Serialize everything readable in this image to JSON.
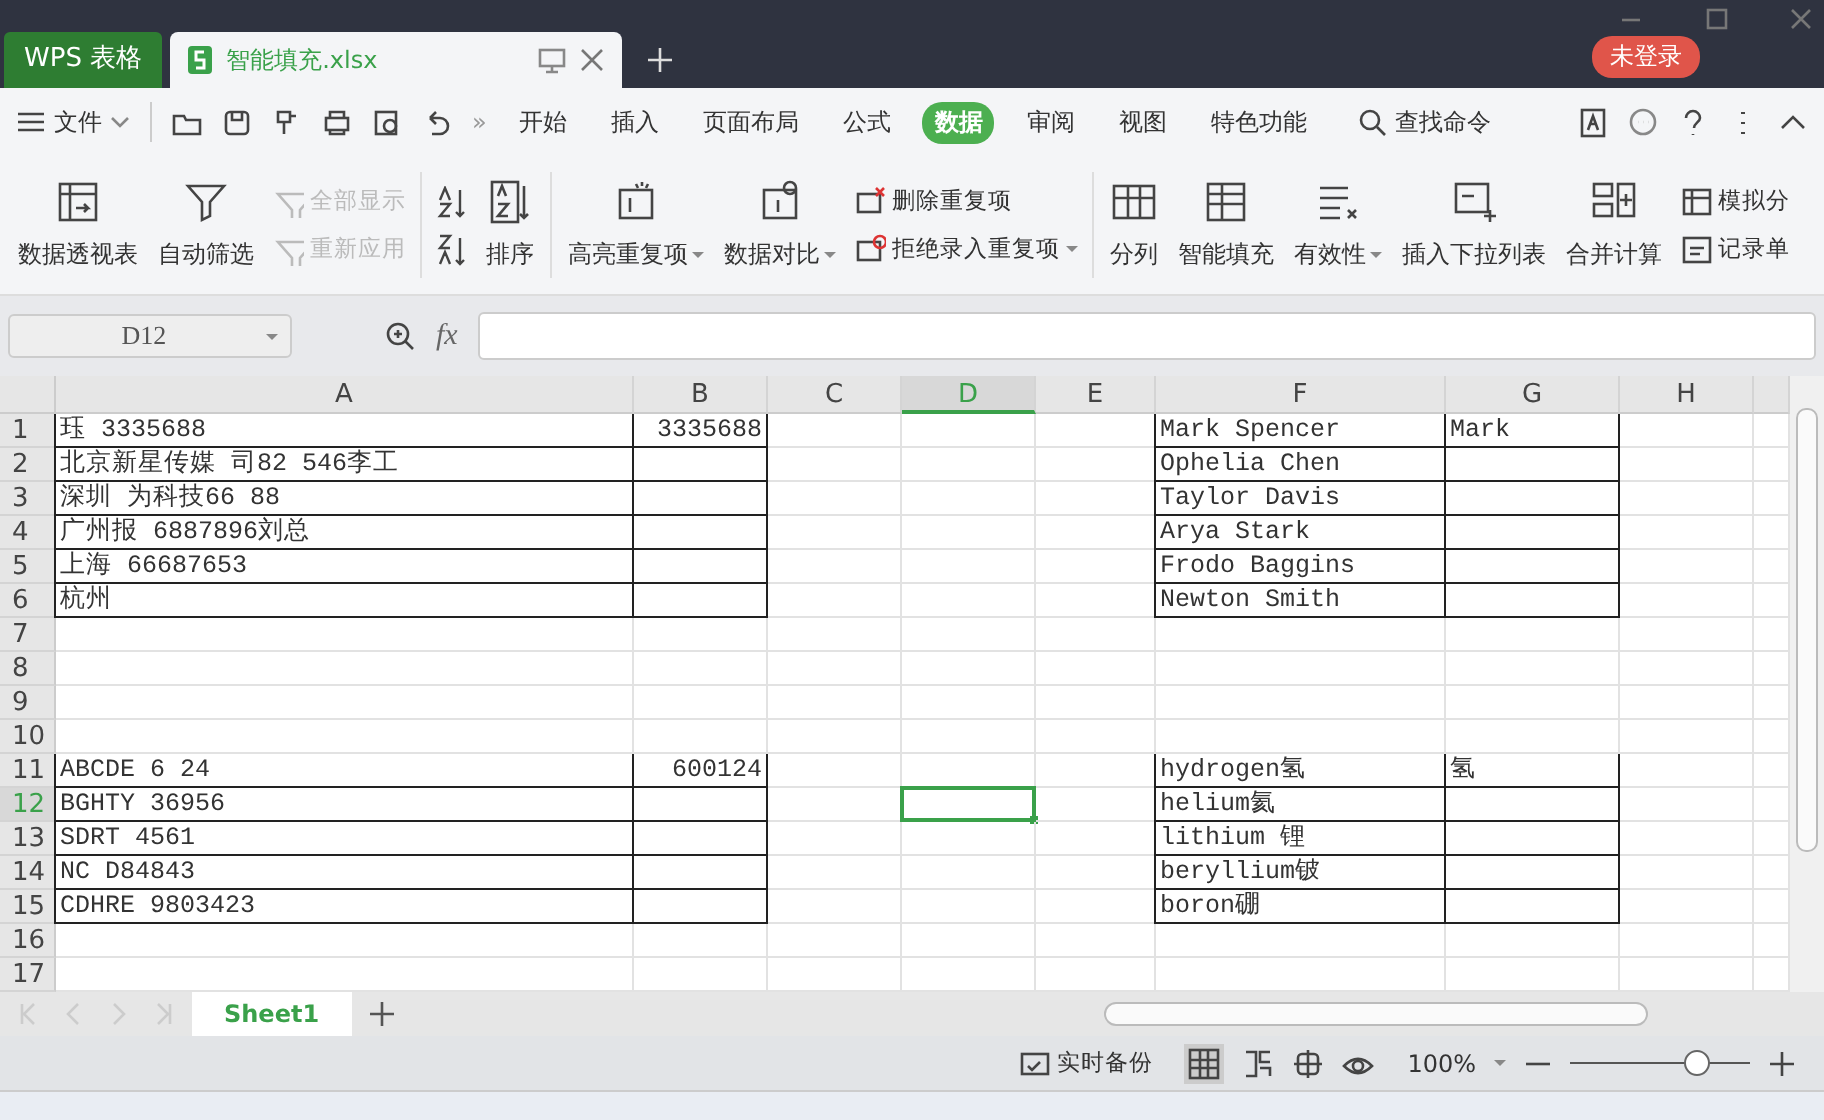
{
  "titlebar": {
    "app_tab": "WPS 表格",
    "doc_tab": {
      "title": "智能填充.xlsx",
      "selected": true
    },
    "login": "未登录"
  },
  "menu": {
    "file": "文件",
    "more": "»",
    "tabs": [
      {
        "label": "开始",
        "selected": false
      },
      {
        "label": "插入",
        "selected": false
      },
      {
        "label": "页面布局",
        "selected": false
      },
      {
        "label": "公式",
        "selected": false
      },
      {
        "label": "数据",
        "selected": true
      },
      {
        "label": "审阅",
        "selected": false
      },
      {
        "label": "视图",
        "selected": false
      },
      {
        "label": "特色功能",
        "selected": false
      }
    ],
    "search": "查找命令"
  },
  "ribbon": [
    {
      "kind": "big",
      "label": "数据透视表",
      "dropdown": false
    },
    {
      "kind": "big",
      "label": "自动筛选",
      "dropdown": false
    },
    {
      "kind": "stack",
      "items": [
        {
          "label": "全部显示",
          "disabled": true,
          "dropdown": false
        },
        {
          "label": "重新应用",
          "disabled": true,
          "dropdown": false
        }
      ]
    },
    {
      "kind": "sep"
    },
    {
      "kind": "sortpair"
    },
    {
      "kind": "big",
      "label": "排序",
      "dropdown": false
    },
    {
      "kind": "sep"
    },
    {
      "kind": "big",
      "label": "高亮重复项",
      "dropdown": true
    },
    {
      "kind": "big",
      "label": "数据对比",
      "dropdown": true
    },
    {
      "kind": "stack",
      "items": [
        {
          "label": "删除重复项",
          "disabled": false,
          "dropdown": false
        },
        {
          "label": "拒绝录入重复项",
          "disabled": false,
          "dropdown": true
        }
      ]
    },
    {
      "kind": "sep"
    },
    {
      "kind": "big",
      "label": "分列",
      "dropdown": false
    },
    {
      "kind": "big",
      "label": "智能填充",
      "dropdown": false
    },
    {
      "kind": "big",
      "label": "有效性",
      "dropdown": true
    },
    {
      "kind": "big",
      "label": "插入下拉列表",
      "dropdown": false
    },
    {
      "kind": "big",
      "label": "合并计算",
      "dropdown": false
    },
    {
      "kind": "stack",
      "items": [
        {
          "label": "模拟分",
          "disabled": false,
          "dropdown": false
        },
        {
          "label": "记录单",
          "disabled": false,
          "dropdown": false
        }
      ]
    }
  ],
  "formula_bar": {
    "name_box": "D12",
    "fx": "fx"
  },
  "sheet": {
    "columns": [
      {
        "label": "A",
        "selected": false
      },
      {
        "label": "B",
        "selected": false
      },
      {
        "label": "C",
        "selected": false
      },
      {
        "label": "D",
        "selected": true
      },
      {
        "label": "E",
        "selected": false
      },
      {
        "label": "F",
        "selected": false
      },
      {
        "label": "G",
        "selected": false
      },
      {
        "label": "H",
        "selected": false
      }
    ],
    "rows": [
      {
        "label": "1",
        "selected": false,
        "cells": [
          {
            "text": "珏 3335688",
            "kind": "text",
            "bordered": true
          },
          {
            "text": "3335688",
            "kind": "number",
            "bordered": true
          },
          {
            "bordered": false
          },
          {
            "bordered": false
          },
          {
            "bordered": false
          },
          {
            "text": "Mark Spencer",
            "kind": "text",
            "bordered": true
          },
          {
            "text": "Mark",
            "kind": "text",
            "bordered": true
          },
          {
            "bordered": false
          }
        ]
      },
      {
        "label": "2",
        "selected": false,
        "cells": [
          {
            "text": "北京新星传媒 司82 546李工",
            "kind": "text",
            "bordered": true
          },
          {
            "bordered": true
          },
          {
            "bordered": false
          },
          {
            "bordered": false
          },
          {
            "bordered": false
          },
          {
            "text": "Ophelia Chen",
            "kind": "text",
            "bordered": true
          },
          {
            "bordered": true
          },
          {
            "bordered": false
          }
        ]
      },
      {
        "label": "3",
        "selected": false,
        "cells": [
          {
            "text": "深圳 为科技66 88",
            "kind": "text",
            "bordered": true
          },
          {
            "bordered": true
          },
          {
            "bordered": false
          },
          {
            "bordered": false
          },
          {
            "bordered": false
          },
          {
            "text": "Taylor Davis",
            "kind": "text",
            "bordered": true
          },
          {
            "bordered": true
          },
          {
            "bordered": false
          }
        ]
      },
      {
        "label": "4",
        "selected": false,
        "cells": [
          {
            "text": "广州报 6887896刘总",
            "kind": "text",
            "bordered": true
          },
          {
            "bordered": true
          },
          {
            "bordered": false
          },
          {
            "bordered": false
          },
          {
            "bordered": false
          },
          {
            "text": "Arya Stark",
            "kind": "text",
            "bordered": true
          },
          {
            "bordered": true
          },
          {
            "bordered": false
          }
        ]
      },
      {
        "label": "5",
        "selected": false,
        "cells": [
          {
            "text": "上海 66687653",
            "kind": "text",
            "bordered": true
          },
          {
            "bordered": true
          },
          {
            "bordered": false
          },
          {
            "bordered": false
          },
          {
            "bordered": false
          },
          {
            "text": "Frodo Baggins",
            "kind": "text",
            "bordered": true
          },
          {
            "bordered": true
          },
          {
            "bordered": false
          }
        ]
      },
      {
        "label": "6",
        "selected": false,
        "cells": [
          {
            "text": "杭州",
            "kind": "text",
            "bordered": true
          },
          {
            "bordered": true
          },
          {
            "bordered": false
          },
          {
            "bordered": false
          },
          {
            "bordered": false
          },
          {
            "text": "Newton Smith",
            "kind": "text",
            "bordered": true
          },
          {
            "bordered": true
          },
          {
            "bordered": false
          }
        ]
      },
      {
        "label": "7",
        "selected": false,
        "cells": [
          {
            "bordered": false
          },
          {
            "bordered": false
          },
          {
            "bordered": false
          },
          {
            "bordered": false
          },
          {
            "bordered": false
          },
          {
            "bordered": false
          },
          {
            "bordered": false
          },
          {
            "bordered": false
          }
        ]
      },
      {
        "label": "8",
        "selected": false,
        "cells": [
          {
            "bordered": false
          },
          {
            "bordered": false
          },
          {
            "bordered": false
          },
          {
            "bordered": false
          },
          {
            "bordered": false
          },
          {
            "bordered": false
          },
          {
            "bordered": false
          },
          {
            "bordered": false
          }
        ]
      },
      {
        "label": "9",
        "selected": false,
        "cells": [
          {
            "bordered": false
          },
          {
            "bordered": false
          },
          {
            "bordered": false
          },
          {
            "bordered": false
          },
          {
            "bordered": false
          },
          {
            "bordered": false
          },
          {
            "bordered": false
          },
          {
            "bordered": false
          }
        ]
      },
      {
        "label": "10",
        "selected": false,
        "cells": [
          {
            "bordered": false
          },
          {
            "bordered": false
          },
          {
            "bordered": false
          },
          {
            "bordered": false
          },
          {
            "bordered": false
          },
          {
            "bordered": false
          },
          {
            "bordered": false
          },
          {
            "bordered": false
          }
        ]
      },
      {
        "label": "11",
        "selected": false,
        "cells": [
          {
            "text": "ABCDE 6 24",
            "kind": "text",
            "bordered": true
          },
          {
            "text": "600124",
            "kind": "number",
            "bordered": true
          },
          {
            "bordered": false
          },
          {
            "bordered": false
          },
          {
            "bordered": false
          },
          {
            "text": "hydrogen氢",
            "kind": "text",
            "bordered": true
          },
          {
            "text": "氢",
            "kind": "text",
            "bordered": true
          },
          {
            "bordered": false
          }
        ]
      },
      {
        "label": "12",
        "selected": true,
        "cells": [
          {
            "text": "BGHTY 36956",
            "kind": "text",
            "bordered": true
          },
          {
            "bordered": true
          },
          {
            "bordered": false
          },
          {
            "bordered": false
          },
          {
            "bordered": false
          },
          {
            "text": "helium氦",
            "kind": "text",
            "bordered": true
          },
          {
            "bordered": true
          },
          {
            "bordered": false
          }
        ]
      },
      {
        "label": "13",
        "selected": false,
        "cells": [
          {
            "text": "SDRT 4561",
            "kind": "text",
            "bordered": true
          },
          {
            "bordered": true
          },
          {
            "bordered": false
          },
          {
            "bordered": false
          },
          {
            "bordered": false
          },
          {
            "text": "lithium 锂",
            "kind": "text",
            "bordered": true
          },
          {
            "bordered": true
          },
          {
            "bordered": false
          }
        ]
      },
      {
        "label": "14",
        "selected": false,
        "cells": [
          {
            "text": "NC D84843",
            "kind": "text",
            "bordered": true
          },
          {
            "bordered": true
          },
          {
            "bordered": false
          },
          {
            "bordered": false
          },
          {
            "bordered": false
          },
          {
            "text": "beryllium铍",
            "kind": "text",
            "bordered": true
          },
          {
            "bordered": true
          },
          {
            "bordered": false
          }
        ]
      },
      {
        "label": "15",
        "selected": false,
        "cells": [
          {
            "text": "CDHRE 9803423",
            "kind": "text",
            "bordered": true
          },
          {
            "bordered": true
          },
          {
            "bordered": false
          },
          {
            "bordered": false
          },
          {
            "bordered": false
          },
          {
            "text": "boron硼",
            "kind": "text",
            "bordered": true
          },
          {
            "bordered": true
          },
          {
            "bordered": false
          }
        ]
      },
      {
        "label": "16",
        "selected": false,
        "cells": [
          {
            "bordered": false
          },
          {
            "bordered": false
          },
          {
            "bordered": false
          },
          {
            "bordered": false
          },
          {
            "bordered": false
          },
          {
            "bordered": false
          },
          {
            "bordered": false
          },
          {
            "bordered": false
          }
        ]
      },
      {
        "label": "17",
        "selected": false,
        "cells": [
          {
            "bordered": false
          },
          {
            "bordered": false
          },
          {
            "bordered": false
          },
          {
            "bordered": false
          },
          {
            "bordered": false
          },
          {
            "bordered": false
          },
          {
            "bordered": false
          },
          {
            "bordered": false
          }
        ]
      }
    ]
  },
  "sheet_tabs": [
    {
      "label": "Sheet1",
      "selected": true
    }
  ],
  "status_bar": {
    "backup": "实时备份",
    "zoom": "100%",
    "zoom_slider": {
      "level": 0.7
    }
  }
}
